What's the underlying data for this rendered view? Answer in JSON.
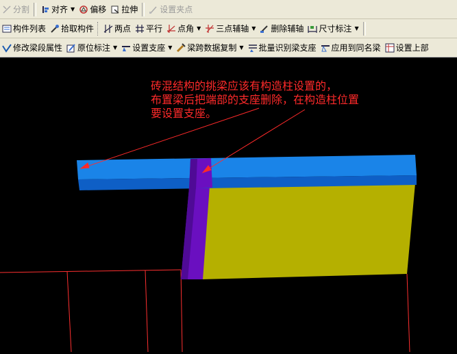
{
  "toolbar1": {
    "split": "分割",
    "align": "对齐",
    "offset": "偏移",
    "stretch": "拉伸",
    "set_pinch_point": "设置夹点"
  },
  "toolbar2": {
    "component_list": "构件列表",
    "pick_component": "拾取构件",
    "two_points": "两点",
    "parallel": "平行",
    "point_angle": "点角",
    "three_point_axis": "三点辅轴",
    "delete_axis": "删除辅轴",
    "dimension": "尺寸标注"
  },
  "toolbar3": {
    "modify_segment_props": "修改梁段属性",
    "in_situ_annotation": "原位标注",
    "set_support": "设置支座",
    "copy_span_data": "梁跨数据复制",
    "batch_identify_support": "批量识别梁支座",
    "apply_same_name": "应用到同名梁",
    "set_upper": "设置上部"
  },
  "canvas": {
    "annotation_line1": "砖混结构的挑梁应该有构造柱设置的，",
    "annotation_line2": "布置梁后把端部的支座删除，在构造柱位置",
    "annotation_line3": "要设置支座。"
  },
  "colors": {
    "background": "#000000",
    "beam_top": "#1a84e8",
    "beam_side": "#0e5fc6",
    "column": "#6a0fc0",
    "wall": "#b5b000",
    "annotation": "#ff2a2a",
    "grid_line": "#ff3030"
  }
}
